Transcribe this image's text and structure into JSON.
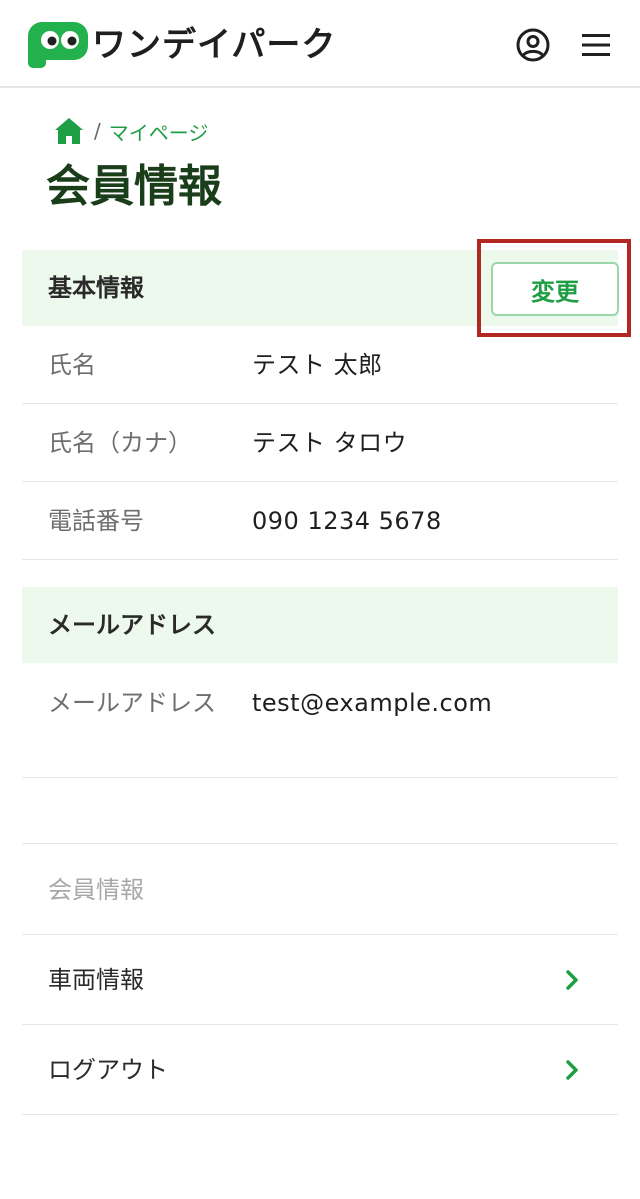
{
  "header": {
    "logo_text": "ワンデイパーク",
    "logo_icon": "p-face-logo-icon",
    "user_icon": "user-circle-icon",
    "menu_icon": "hamburger-menu-icon"
  },
  "breadcrumb": {
    "home_icon": "home-icon",
    "separator": "/",
    "current": "マイページ"
  },
  "page_title": "会員情報",
  "basic_info": {
    "heading": "基本情報",
    "change_label": "変更",
    "rows": [
      {
        "label": "氏名",
        "value": "テスト 太郎"
      },
      {
        "label": "氏名（カナ）",
        "value": "テスト タロウ"
      },
      {
        "label": "電話番号",
        "value": "090 1234 5678"
      }
    ]
  },
  "email_info": {
    "heading": "メールアドレス",
    "rows": [
      {
        "label": "メールアドレス",
        "value": "test@example.com"
      }
    ]
  },
  "menu": {
    "heading": "会員情報",
    "items": [
      {
        "label": "車両情報",
        "icon": "chevron-right-icon"
      },
      {
        "label": "ログアウト",
        "icon": "chevron-right-icon"
      }
    ]
  },
  "colors": {
    "brand_green": "#1e9e45",
    "section_bg": "#eef9ee",
    "highlight_red": "#b0281f"
  }
}
